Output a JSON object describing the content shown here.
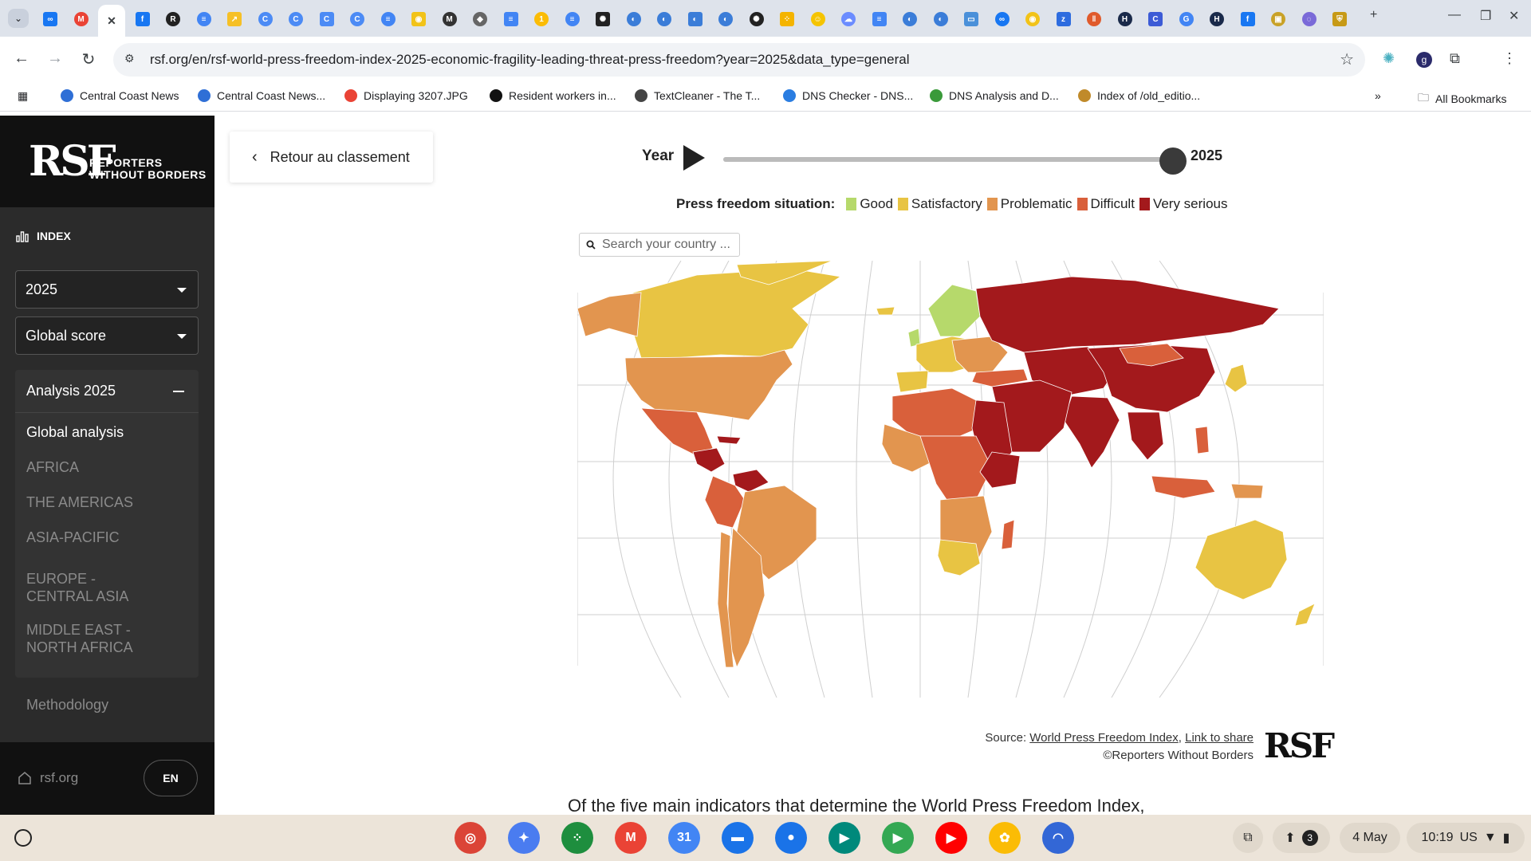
{
  "browser": {
    "tab_favicons": [
      {
        "name": "meta",
        "color": "#1877f2",
        "glyph": "∞"
      },
      {
        "name": "gmail",
        "color": "#ea4335",
        "glyph": "M"
      },
      {
        "name": "active-close",
        "color": "#ffffff",
        "glyph": "✕"
      },
      {
        "name": "facebook",
        "color": "#1877f2",
        "glyph": "f"
      },
      {
        "name": "rsf",
        "color": "#222222",
        "glyph": "R"
      },
      {
        "name": "docs",
        "color": "#4285f4",
        "glyph": "≡"
      },
      {
        "name": "arrow",
        "color": "#f6c026",
        "glyph": "↗"
      },
      {
        "name": "c1",
        "color": "#4c8bf5",
        "glyph": "C"
      },
      {
        "name": "c2",
        "color": "#4c8bf5",
        "glyph": "C"
      },
      {
        "name": "c3",
        "color": "#4c8bf5",
        "glyph": "C"
      },
      {
        "name": "c4",
        "color": "#4c8bf5",
        "glyph": "C"
      },
      {
        "name": "docs2",
        "color": "#4285f4",
        "glyph": "≡"
      },
      {
        "name": "yellow",
        "color": "#f2c318",
        "glyph": "◉"
      },
      {
        "name": "m",
        "color": "#333333",
        "glyph": "M"
      },
      {
        "name": "crab",
        "color": "#666666",
        "glyph": "◆"
      },
      {
        "name": "docs3",
        "color": "#4285f4",
        "glyph": "≡"
      },
      {
        "name": "one",
        "color": "#fbbc05",
        "glyph": "1"
      },
      {
        "name": "docs4",
        "color": "#4285f4",
        "glyph": "≡"
      },
      {
        "name": "openai1",
        "color": "#222222",
        "glyph": "✺"
      },
      {
        "name": "sn1",
        "color": "#3b7dd8",
        "glyph": "◐"
      },
      {
        "name": "sn2",
        "color": "#3b7dd8",
        "glyph": "◐"
      },
      {
        "name": "sn3",
        "color": "#3b7dd8",
        "glyph": "◐"
      },
      {
        "name": "sn4",
        "color": "#3b7dd8",
        "glyph": "◐"
      },
      {
        "name": "openai2",
        "color": "#222222",
        "glyph": "✺"
      },
      {
        "name": "dots",
        "color": "#f4b400",
        "glyph": "⁘"
      },
      {
        "name": "emoji",
        "color": "#f5c400",
        "glyph": "☺"
      },
      {
        "name": "cloud",
        "color": "#6b8cff",
        "glyph": "☁"
      },
      {
        "name": "docs5",
        "color": "#4285f4",
        "glyph": "≡"
      },
      {
        "name": "sn5",
        "color": "#3b7dd8",
        "glyph": "◐"
      },
      {
        "name": "sn6",
        "color": "#3b7dd8",
        "glyph": "◐"
      },
      {
        "name": "card",
        "color": "#4a90d9",
        "glyph": "▭"
      },
      {
        "name": "meta2",
        "color": "#1877f2",
        "glyph": "∞"
      },
      {
        "name": "yellow2",
        "color": "#f2c318",
        "glyph": "◉"
      },
      {
        "name": "zm",
        "color": "#2d6cdf",
        "glyph": "z"
      },
      {
        "name": "bars",
        "color": "#e05a2b",
        "glyph": "‖"
      },
      {
        "name": "hl",
        "color": "#1a2a4a",
        "glyph": "H"
      },
      {
        "name": "cg",
        "color": "#3c5bd6",
        "glyph": "C"
      },
      {
        "name": "google",
        "color": "#4285f4",
        "glyph": "G"
      },
      {
        "name": "hl2",
        "color": "#1a2a4a",
        "glyph": "H"
      },
      {
        "name": "facebook2",
        "color": "#1877f2",
        "glyph": "f"
      },
      {
        "name": "frame",
        "color": "#c9a227",
        "glyph": "▣"
      },
      {
        "name": "chat",
        "color": "#7a6ad8",
        "glyph": "◌"
      },
      {
        "name": "shield",
        "color": "#c79a16",
        "glyph": "⛨"
      }
    ],
    "url": "rsf.org/en/rsf-world-press-freedom-index-2025-economic-fragility-leading-threat-press-freedom?year=2025&data_type=general",
    "bookmarks": [
      {
        "label": "Central Coast News",
        "color": "#2f6fd6"
      },
      {
        "label": "Central Coast News...",
        "color": "#2f6fd6"
      },
      {
        "label": "Displaying 3207.JPG",
        "color": "#ea4335"
      },
      {
        "label": "Resident workers in...",
        "color": "#111111"
      },
      {
        "label": "TextCleaner - The T...",
        "color": "#444444"
      },
      {
        "label": "DNS Checker - DNS...",
        "color": "#2a7de1"
      },
      {
        "label": "DNS Analysis and D...",
        "color": "#3a9a3a"
      },
      {
        "label": "Index of /old_editio...",
        "color": "#c08a2a"
      }
    ],
    "bookmarks_overflow": "»",
    "all_bookmarks": "All Bookmarks"
  },
  "sidebar": {
    "logo_mark": "RSF",
    "logo_text_1": "REPORTERS",
    "logo_text_2": "WITHOUT BORDERS",
    "index_label": "INDEX",
    "year_select": "2025",
    "score_select": "Global score",
    "analysis_title": "Analysis 2025",
    "analysis_items": [
      "Global analysis",
      "AFRICA",
      "THE AMERICAS",
      "ASIA-PACIFIC",
      "EUROPE - CENTRAL ASIA",
      "MIDDLE EAST - NORTH AFRICA"
    ],
    "methodology": "Methodology",
    "site_link": "rsf.org",
    "lang": "EN"
  },
  "main": {
    "back_label": "Retour au classement",
    "year_label": "Year",
    "year_value": "2025",
    "slider_progress": 1.0,
    "legend_title": "Press freedom situation:",
    "legend": [
      {
        "label": "Good",
        "color": "#b6d96b"
      },
      {
        "label": "Satisfactory",
        "color": "#e8c443"
      },
      {
        "label": "Problematic",
        "color": "#e2954f"
      },
      {
        "label": "Difficult",
        "color": "#d9603b"
      },
      {
        "label": "Very serious",
        "color": "#a3191c"
      }
    ],
    "search_placeholder": "Search your country ...",
    "source_prefix": "Source:",
    "source_link1": "World Press Freedom Index",
    "source_sep": ",",
    "source_link2": "Link to share",
    "copyright": "©Reporters Without Borders",
    "rsf_mini": "RSF",
    "body_text": "Of the five main indicators that determine the World Press Freedom Index,"
  },
  "shelf": {
    "apps": [
      {
        "name": "chrome",
        "color": "#db4437",
        "glyph": "◎"
      },
      {
        "name": "gemini",
        "color": "#4a7cf0",
        "glyph": "✦"
      },
      {
        "name": "apps-grid",
        "color": "#1e8e3e",
        "glyph": "⁘"
      },
      {
        "name": "gmail",
        "color": "#ea4335",
        "glyph": "M"
      },
      {
        "name": "calendar",
        "color": "#4285f4",
        "glyph": "31"
      },
      {
        "name": "files",
        "color": "#1a73e8",
        "glyph": "▬"
      },
      {
        "name": "messages",
        "color": "#1a73e8",
        "glyph": "●"
      },
      {
        "name": "meet",
        "color": "#00897b",
        "glyph": "▶"
      },
      {
        "name": "play-store",
        "color": "#34a853",
        "glyph": "▶"
      },
      {
        "name": "youtube",
        "color": "#ff0000",
        "glyph": "▶"
      },
      {
        "name": "photos",
        "color": "#fbbc05",
        "glyph": "✿"
      },
      {
        "name": "podcast",
        "color": "#3367d6",
        "glyph": "◠"
      }
    ],
    "notif_count": "3",
    "date": "4 May",
    "time": "10:19",
    "locale": "US"
  }
}
